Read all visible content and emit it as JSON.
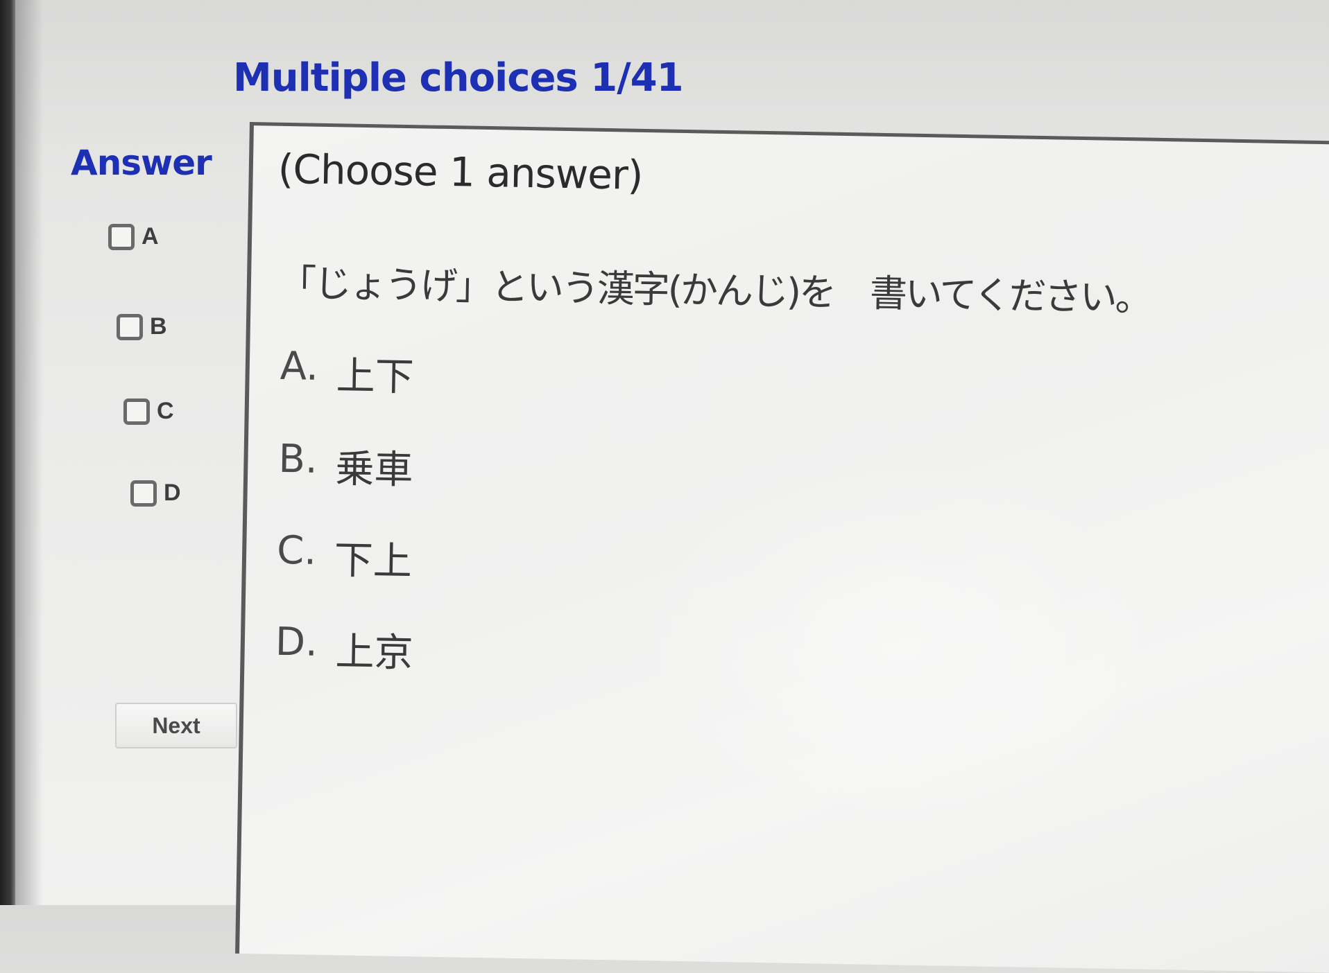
{
  "header": {
    "title": "Multiple choices 1/41"
  },
  "answer_panel": {
    "heading": "Answer",
    "options": [
      {
        "letter": "A"
      },
      {
        "letter": "B"
      },
      {
        "letter": "C"
      },
      {
        "letter": "D"
      }
    ],
    "next_label": "Next"
  },
  "question": {
    "instruction": "(Choose 1 answer)",
    "text": "「じょうげ」という漢字(かんじ)を　書いてください。",
    "choices": [
      {
        "label": "A.",
        "text": "上下"
      },
      {
        "label": "B.",
        "text": "乗車"
      },
      {
        "label": "C.",
        "text": "下上"
      },
      {
        "label": "D.",
        "text": "上京"
      }
    ]
  },
  "colors": {
    "heading_blue": "#1d2fb3",
    "text_gray": "#3a3a3a"
  }
}
